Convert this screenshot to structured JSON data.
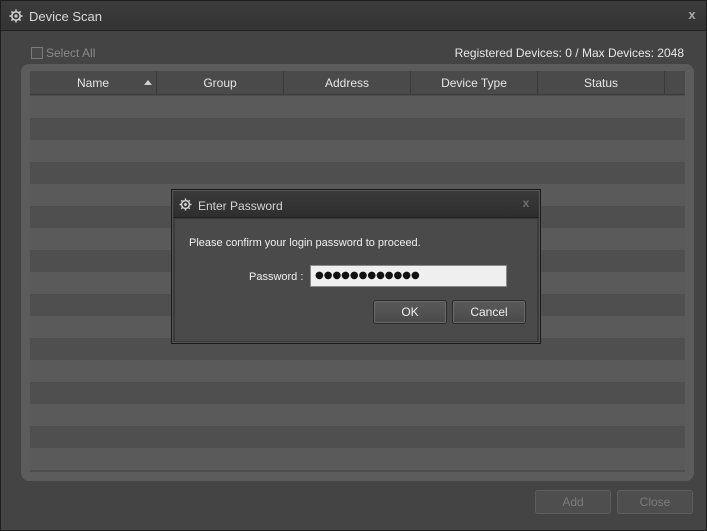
{
  "window": {
    "title": "Device Scan",
    "close_glyph": "x"
  },
  "toolbar": {
    "select_all_label": "Select All",
    "select_all_checked": false,
    "device_count": "Registered Devices: 0 / Max Devices: 2048"
  },
  "table": {
    "columns": [
      "Name",
      "Group",
      "Address",
      "Device Type",
      "Status"
    ],
    "sort_column": "Name",
    "sort_direction": "ascending",
    "rows": []
  },
  "footer": {
    "add_label": "Add",
    "close_label": "Close"
  },
  "dialog": {
    "title": "Enter Password",
    "close_glyph": "x",
    "message": "Please confirm your login password to proceed.",
    "password_label": "Password :",
    "password_value": "●●●●●●●●●●●●",
    "ok_label": "OK",
    "cancel_label": "Cancel"
  },
  "icons": {
    "window_icon": "gear-icon",
    "dialog_icon": "gear-icon",
    "sort_icon": "sort-ascending-icon"
  },
  "colors": {
    "window_bg": "#444444",
    "panel_bg": "#5c5c5c",
    "row_light": "#5a5a5a",
    "row_dark": "#4f4f4f",
    "dialog_bg": "#4a4a4a",
    "input_bg": "#efefef"
  }
}
